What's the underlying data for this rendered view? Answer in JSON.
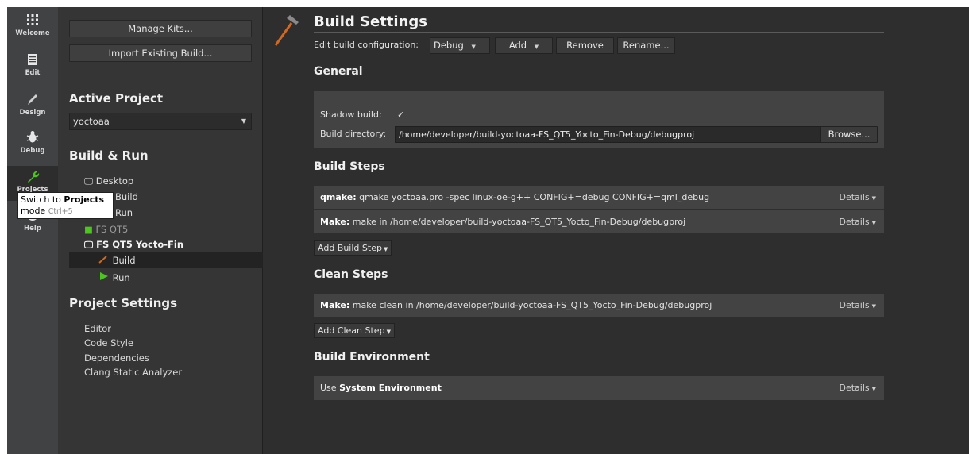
{
  "modebar": {
    "items": [
      {
        "label": "Welcome",
        "icon": "grid-icon"
      },
      {
        "label": "Edit",
        "icon": "document-icon"
      },
      {
        "label": "Design",
        "icon": "pen-icon"
      },
      {
        "label": "Debug",
        "icon": "bug-icon"
      },
      {
        "label": "Projects",
        "icon": "wrench-icon"
      },
      {
        "label": "Help",
        "icon": "help-icon"
      }
    ]
  },
  "tooltip": {
    "prefix": "Switch to",
    "bold": "Projects",
    "suffix": "mode",
    "shortcut": "Ctrl+5"
  },
  "sidebar": {
    "manage_kits": "Manage Kits...",
    "import_build": "Import Existing Build...",
    "active_project_heading": "Active Project",
    "active_project_value": "yoctoaa",
    "build_run_heading": "Build & Run",
    "tree": {
      "desktop": "Desktop",
      "desktop_build": "Build",
      "desktop_run": "Run",
      "fs_qt5": "FS QT5",
      "fs_qt5_yocto": "FS QT5 Yocto-Fin",
      "yocto_build": "Build",
      "yocto_run": "Run"
    },
    "project_settings_heading": "Project Settings",
    "settings_items": [
      "Editor",
      "Code Style",
      "Dependencies",
      "Clang Static Analyzer"
    ]
  },
  "main": {
    "title": "Build Settings",
    "edit_config_label": "Edit build configuration:",
    "config_value": "Debug",
    "add_label": "Add",
    "remove_label": "Remove",
    "rename_label": "Rename...",
    "general": {
      "heading": "General",
      "shadow_label": "Shadow build:",
      "shadow_check": "✓",
      "dir_label": "Build directory:",
      "dir_value": "/home/developer/build-yoctoaa-FS_QT5_Yocto_Fin-Debug/debugproj",
      "browse_label": "Browse..."
    },
    "build_steps": {
      "heading": "Build Steps",
      "steps": [
        {
          "name": "qmake:",
          "text": "qmake yoctoaa.pro -spec linux-oe-g++ CONFIG+=debug CONFIG+=qml_debug"
        },
        {
          "name": "Make:",
          "text": "make in /home/developer/build-yoctoaa-FS_QT5_Yocto_Fin-Debug/debugproj"
        }
      ],
      "add_label": "Add Build Step"
    },
    "clean_steps": {
      "heading": "Clean Steps",
      "steps": [
        {
          "name": "Make:",
          "text": "make clean in /home/developer/build-yoctoaa-FS_QT5_Yocto_Fin-Debug/debugproj"
        }
      ],
      "add_label": "Add Clean Step"
    },
    "environment": {
      "heading": "Build Environment",
      "prefix": "Use",
      "bold": "System Environment"
    },
    "details_label": "Details"
  },
  "colors": {
    "modebar_bg": "#404244",
    "sidebar_bg": "#353535",
    "main_bg": "#2e2e2e",
    "panel_bg": "#434343",
    "accent_green": "#4cc61e",
    "hammer_orange": "#d2691e"
  }
}
